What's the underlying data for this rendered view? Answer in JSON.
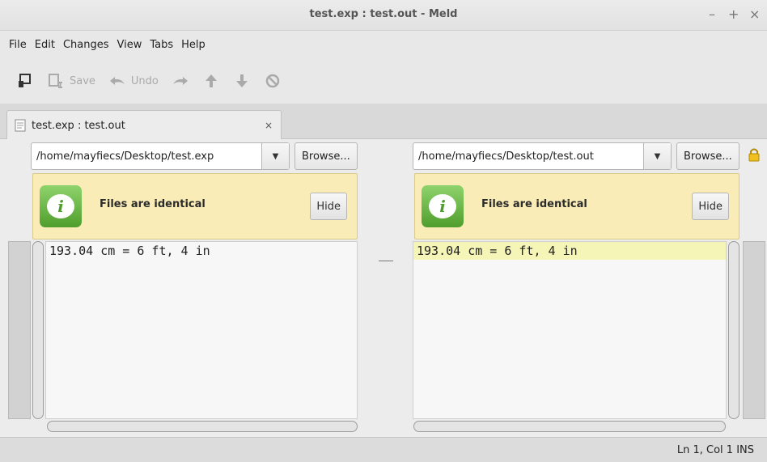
{
  "window": {
    "title": "test.exp : test.out - Meld",
    "controls": [
      "–",
      "+",
      "×"
    ]
  },
  "menu": [
    "File",
    "Edit",
    "Changes",
    "View",
    "Tabs",
    "Help"
  ],
  "toolbar": {
    "save_label": "Save",
    "undo_label": "Undo"
  },
  "tab": {
    "label": "test.exp : test.out",
    "close": "×"
  },
  "left_pane": {
    "path": "/home/mayfiecs/Desktop/test.exp",
    "browse_label": "Browse...",
    "info_message": "Files are identical",
    "hide_label": "Hide",
    "lines": [
      "193.04 cm = 6 ft, 4 in"
    ]
  },
  "right_pane": {
    "path": "/home/mayfiecs/Desktop/test.out",
    "browse_label": "Browse...",
    "info_message": "Files are identical",
    "hide_label": "Hide",
    "lines": [
      "193.04 cm = 6 ft, 4 in"
    ]
  },
  "status": {
    "position": "Ln 1, Col 1",
    "mode": "INS"
  },
  "colors": {
    "highlight_line": "#f5f5b8",
    "infobar": "#faecb6",
    "info_icon": "#5fae3a"
  }
}
